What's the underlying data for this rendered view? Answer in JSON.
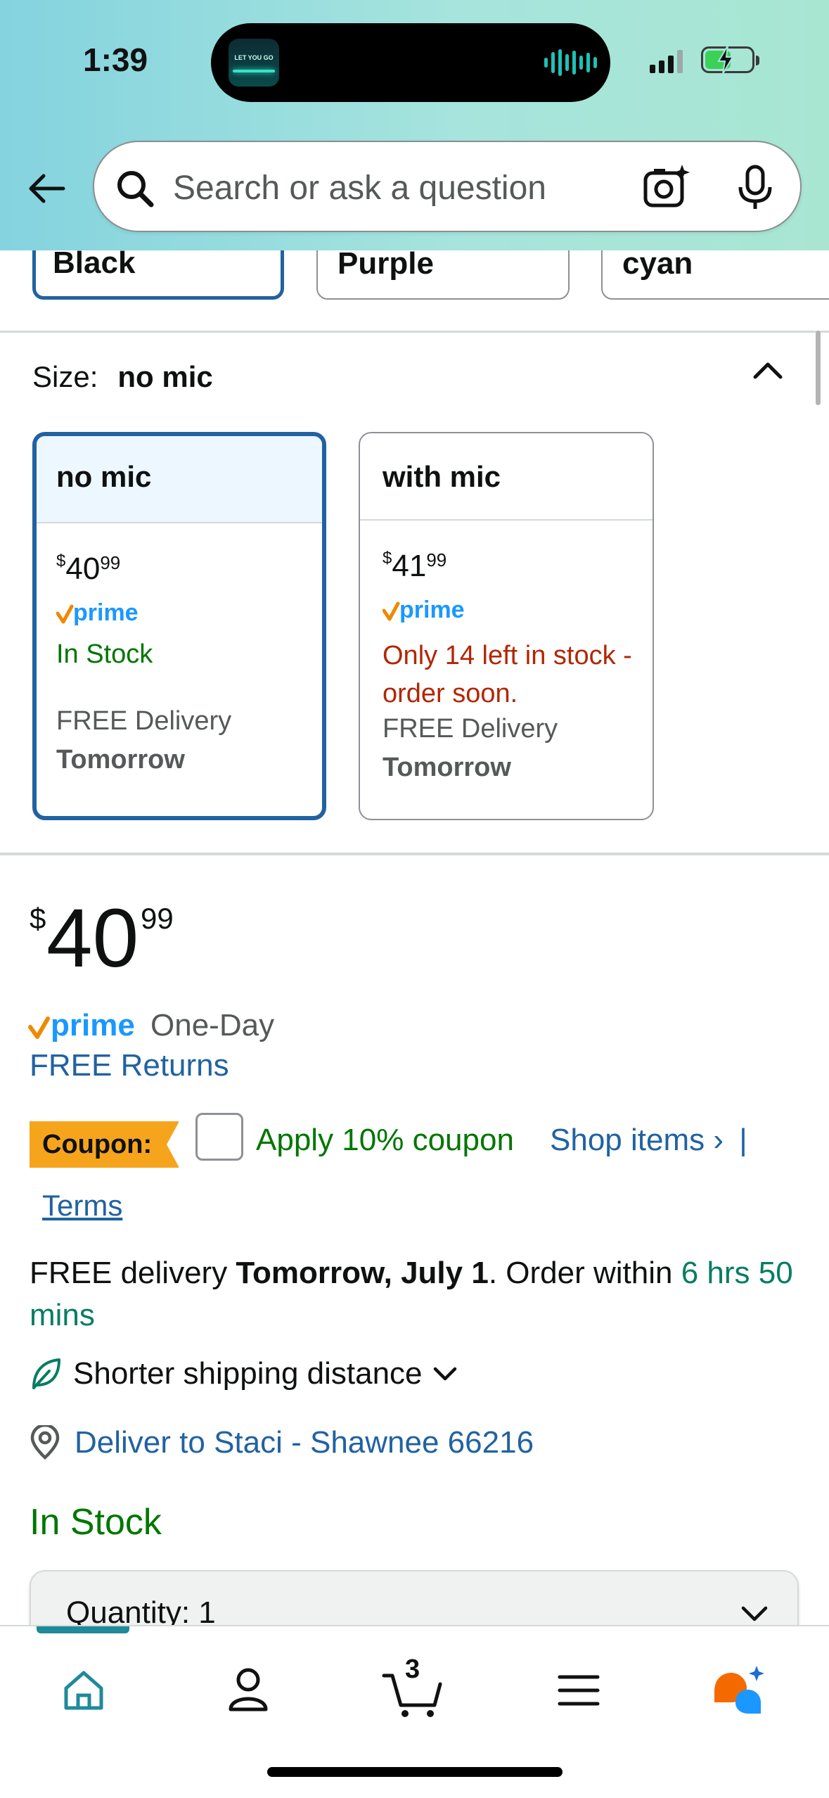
{
  "status_bar": {
    "time": "1:39",
    "now_playing_art_text": "LET YOU GO"
  },
  "search": {
    "placeholder": "Search or ask a question"
  },
  "colors": [
    {
      "label": "Black",
      "selected": true
    },
    {
      "label": "Purple",
      "selected": false
    },
    {
      "label": "cyan",
      "selected": false
    }
  ],
  "size": {
    "label": "Size:",
    "selected_value": "no mic",
    "options": [
      {
        "name": "no mic",
        "price_symbol": "$",
        "price_whole": "40",
        "price_cents": "99",
        "prime": "prime",
        "stock": "In Stock",
        "delivery_label": "FREE Delivery",
        "delivery_day": "Tomorrow",
        "selected": true
      },
      {
        "name": "with mic",
        "price_symbol": "$",
        "price_whole": "41",
        "price_cents": "99",
        "prime": "prime",
        "stock": "Only 14 left in stock - order soon.",
        "delivery_label": "FREE Delivery",
        "delivery_day": "Tomorrow",
        "selected": false
      }
    ]
  },
  "price": {
    "symbol": "$",
    "whole": "40",
    "cents": "99"
  },
  "prime_line": {
    "prime": "prime",
    "speed": "One-Day"
  },
  "returns": "FREE Returns",
  "coupon": {
    "badge": "Coupon:",
    "apply_text": "Apply 10% coupon",
    "shop_items": "Shop items ›",
    "separator": "|",
    "terms": "Terms"
  },
  "delivery": {
    "prefix": "FREE delivery ",
    "date": "Tomorrow, July 1",
    "middle": ". Order within ",
    "countdown": "6 hrs 50 mins"
  },
  "shipping_note": "Shorter shipping distance",
  "deliver_to": "Deliver to Staci - Shawnee 66216",
  "stock_status": "In Stock",
  "quantity": {
    "label": "Quantity: 1"
  },
  "bottom_nav": {
    "cart_count": "3"
  },
  "theme": {
    "link": "#2162a1",
    "green": "#007600",
    "red": "#b12704",
    "coupon": "#f7a41d",
    "selected_border": "#2162a1"
  }
}
